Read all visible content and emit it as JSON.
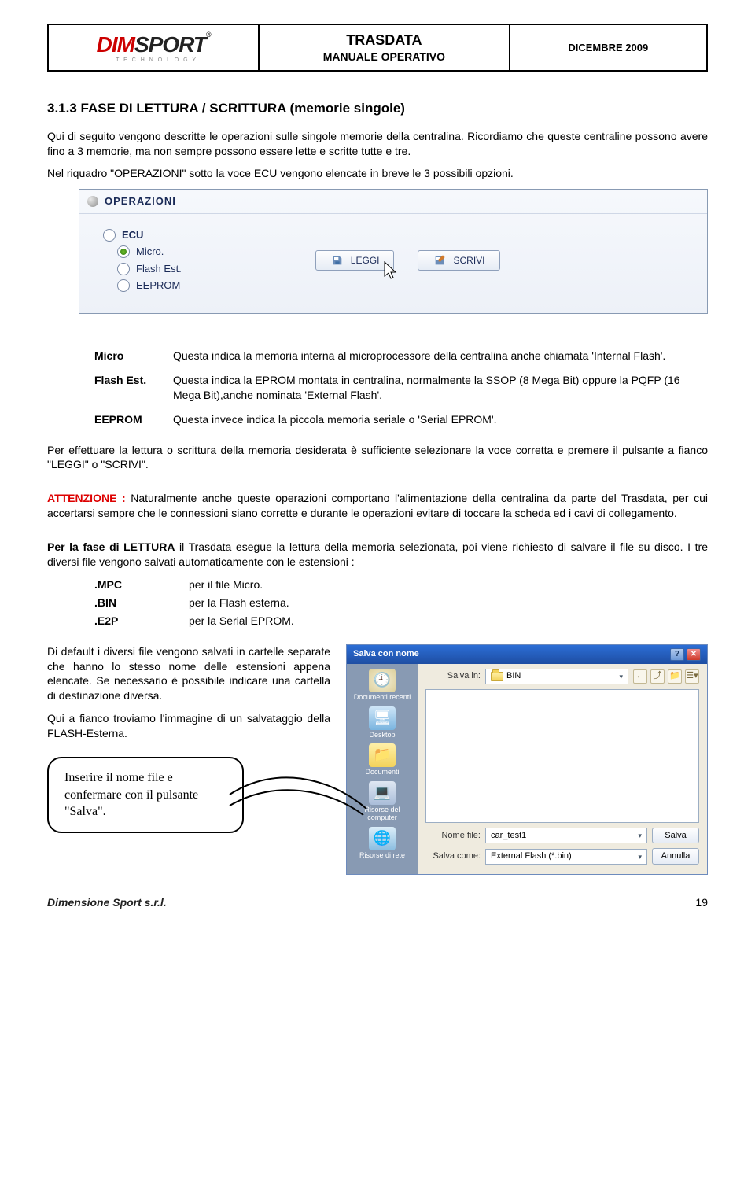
{
  "header": {
    "title_line1": "TRASDATA",
    "title_line2": "MANUALE OPERATIVO",
    "date": "DICEMBRE 2009",
    "logo_main_red": "DIM",
    "logo_main_dark": "SPORT",
    "logo_sub": "T E C H N O L O G Y",
    "logo_reg": "®"
  },
  "section": {
    "number_title": "3.1.3 FASE DI LETTURA / SCRITTURA (memorie singole)",
    "intro_p1": "Qui di seguito vengono descritte le operazioni sulle singole memorie della centralina. Ricordiamo che queste centraline possono avere fino a 3 memorie, ma non sempre possono essere lette e scritte tutte e tre.",
    "intro_p2": "Nel riquadro \"OPERAZIONI\" sotto la voce ECU vengono elencate in breve le 3 possibili opzioni."
  },
  "panel": {
    "title": "OPERAZIONI",
    "radios": [
      "ECU",
      "Micro.",
      "Flash Est.",
      "EEPROM"
    ],
    "selected_index": 1,
    "btn_leggi": "LEGGI",
    "btn_scrivi": "SCRIVI"
  },
  "definitions": [
    {
      "term": "Micro",
      "desc": "Questa indica la memoria interna al microprocessore della centralina anche chiamata 'Internal Flash'."
    },
    {
      "term": "Flash Est.",
      "desc": "Questa indica la EPROM montata in centralina, normalmente la SSOP (8 Mega Bit) oppure la PQFP (16 Mega Bit),anche nominata 'External Flash'."
    },
    {
      "term": "EEPROM",
      "desc": "Questa invece indica la piccola memoria seriale o 'Serial EPROM'."
    }
  ],
  "para_after_defs": "Per effettuare la lettura o scrittura della memoria desiderata è sufficiente selezionare la voce corretta e premere il pulsante a fianco \"LEGGI\" o \"SCRIVI\".",
  "attention_label": "ATTENZIONE :",
  "attention_body": " Naturalmente anche queste operazioni comportano l'alimentazione della centralina da parte del Trasdata, per cui accertarsi sempre che le connessioni siano corrette e durante le operazioni evitare di toccare la scheda ed i cavi di collegamento.",
  "lettura_para": "Per la fase di LETTURA il Trasdata esegue la lettura della memoria selezionata, poi viene richiesto di salvare il file su disco. I tre diversi file vengono salvati automaticamente con le estensioni :",
  "extensions": [
    {
      "ext": ".MPC",
      "desc": "per il file Micro."
    },
    {
      "ext": ".BIN",
      "desc": "per la Flash esterna."
    },
    {
      "ext": ".E2P",
      "desc": "per la Serial EPROM."
    }
  ],
  "bottom_p1": "Di default i diversi file vengono salvati in cartelle separate che hanno lo stesso nome delle estensioni appena elencate. Se necessario è possibile indicare una cartella di destinazione diversa.",
  "bottom_p2": "Qui a fianco troviamo l'immagine di un salvataggio della FLASH-Esterna.",
  "callout": "Inserire il nome file e confermare con il pulsante \"Salva\".",
  "dialog": {
    "title": "Salva con nome",
    "save_in_label": "Salva in:",
    "save_in_value": "BIN",
    "places": [
      "Documenti recenti",
      "Desktop",
      "Documenti",
      "Risorse del computer",
      "Risorse di rete"
    ],
    "name_label": "Nome file:",
    "name_value": "car_test1",
    "type_label": "Salva come:",
    "type_value": "External Flash (*.bin)",
    "btn_save": "Salva",
    "btn_cancel": "Annulla"
  },
  "footer": {
    "company": "Dimensione Sport s.r.l.",
    "page_num": "19"
  }
}
